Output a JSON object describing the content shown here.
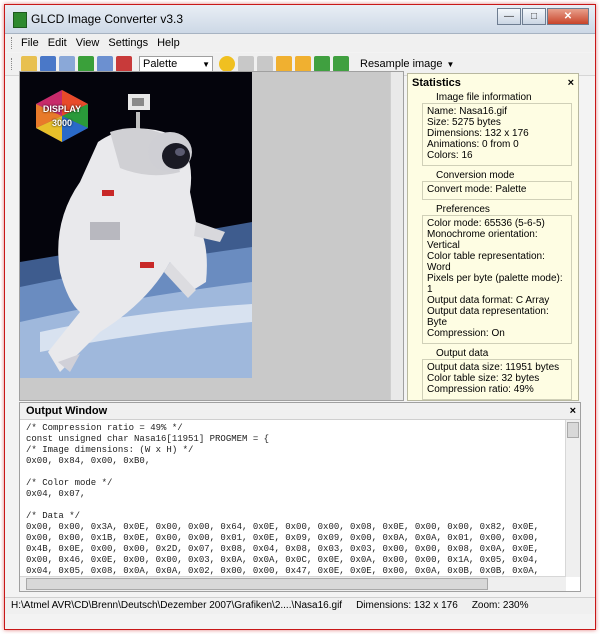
{
  "window": {
    "title": "GLCD Image Converter v3.3",
    "buttons": [
      "—",
      "□",
      "✕"
    ]
  },
  "menu": [
    "File",
    "Edit",
    "View",
    "Settings",
    "Help"
  ],
  "toolbar": {
    "palette_value": "Palette",
    "resample_label": "Resample image"
  },
  "logo_text": "DISPLAY 3000",
  "stats": {
    "title": "Statistics",
    "image_info": {
      "title": "Image file information",
      "lines": [
        "Name: Nasa16.gif",
        "Size: 5275 bytes",
        "Dimensions: 132 x 176",
        "Animations: 0 from 0",
        "Colors: 16"
      ]
    },
    "conversion": {
      "title": "Conversion mode",
      "lines": [
        "Convert mode: Palette"
      ]
    },
    "preferences": {
      "title": "Preferences",
      "lines": [
        "Color mode: 65536 (5-6-5)",
        "Monochrome orientation: Vertical",
        "Color table representation: Word",
        "Pixels per byte (palette mode): 1",
        "Output data format: C Array",
        "Output data representation: Byte",
        "Compression: On"
      ]
    },
    "output": {
      "title": "Output data",
      "lines": [
        "Output data size: 11951 bytes",
        "Color table size: 32 bytes",
        "Compression ratio: 49%"
      ]
    }
  },
  "output_window": {
    "title": "Output Window",
    "code": [
      "/* Compression ratio = 49% */",
      "const unsigned char Nasa16[11951] PROGMEM = {",
      "/* Image dimensions: (W x H) */",
      "0x00, 0x84, 0x00, 0xB0,",
      "",
      "/* Color mode */",
      "0x04, 0x07,",
      "",
      "/* Data */",
      "0x00, 0x00, 0x3A, 0x0E, 0x00, 0x00, 0x64, 0x0E, 0x00, 0x00, 0x08, 0x0E, 0x00, 0x00, 0x82, 0x0E,",
      "0x00, 0x00, 0x1B, 0x0E, 0x00, 0x00, 0x01, 0x0E, 0x09, 0x09, 0x00, 0x0A, 0x0A, 0x01, 0x00, 0x00,",
      "0x4B, 0x0E, 0x00, 0x00, 0x2D, 0x07, 0x08, 0x04, 0x08, 0x03, 0x03, 0x00, 0x00, 0x08, 0x0A, 0x0E,",
      "0x00, 0x46, 0x0E, 0x00, 0x00, 0x03, 0x0A, 0x0A, 0x0C, 0x0E, 0x0A, 0x00, 0x00, 0x1A, 0x05, 0x04,",
      "0x04, 0x05, 0x08, 0x0A, 0x0A, 0x02, 0x00, 0x00, 0x47, 0x0E, 0x0E, 0x00, 0x0A, 0x0B, 0x0B, 0x0A,"
    ]
  },
  "statusbar": {
    "path": "H:\\Atmel AVR\\CD\\Brenn\\Deutsch\\Dezember 2007\\Grafiken\\2....\\Nasa16.gif",
    "dimensions": "Dimensions: 132 x 176",
    "zoom": "Zoom: 230%"
  }
}
